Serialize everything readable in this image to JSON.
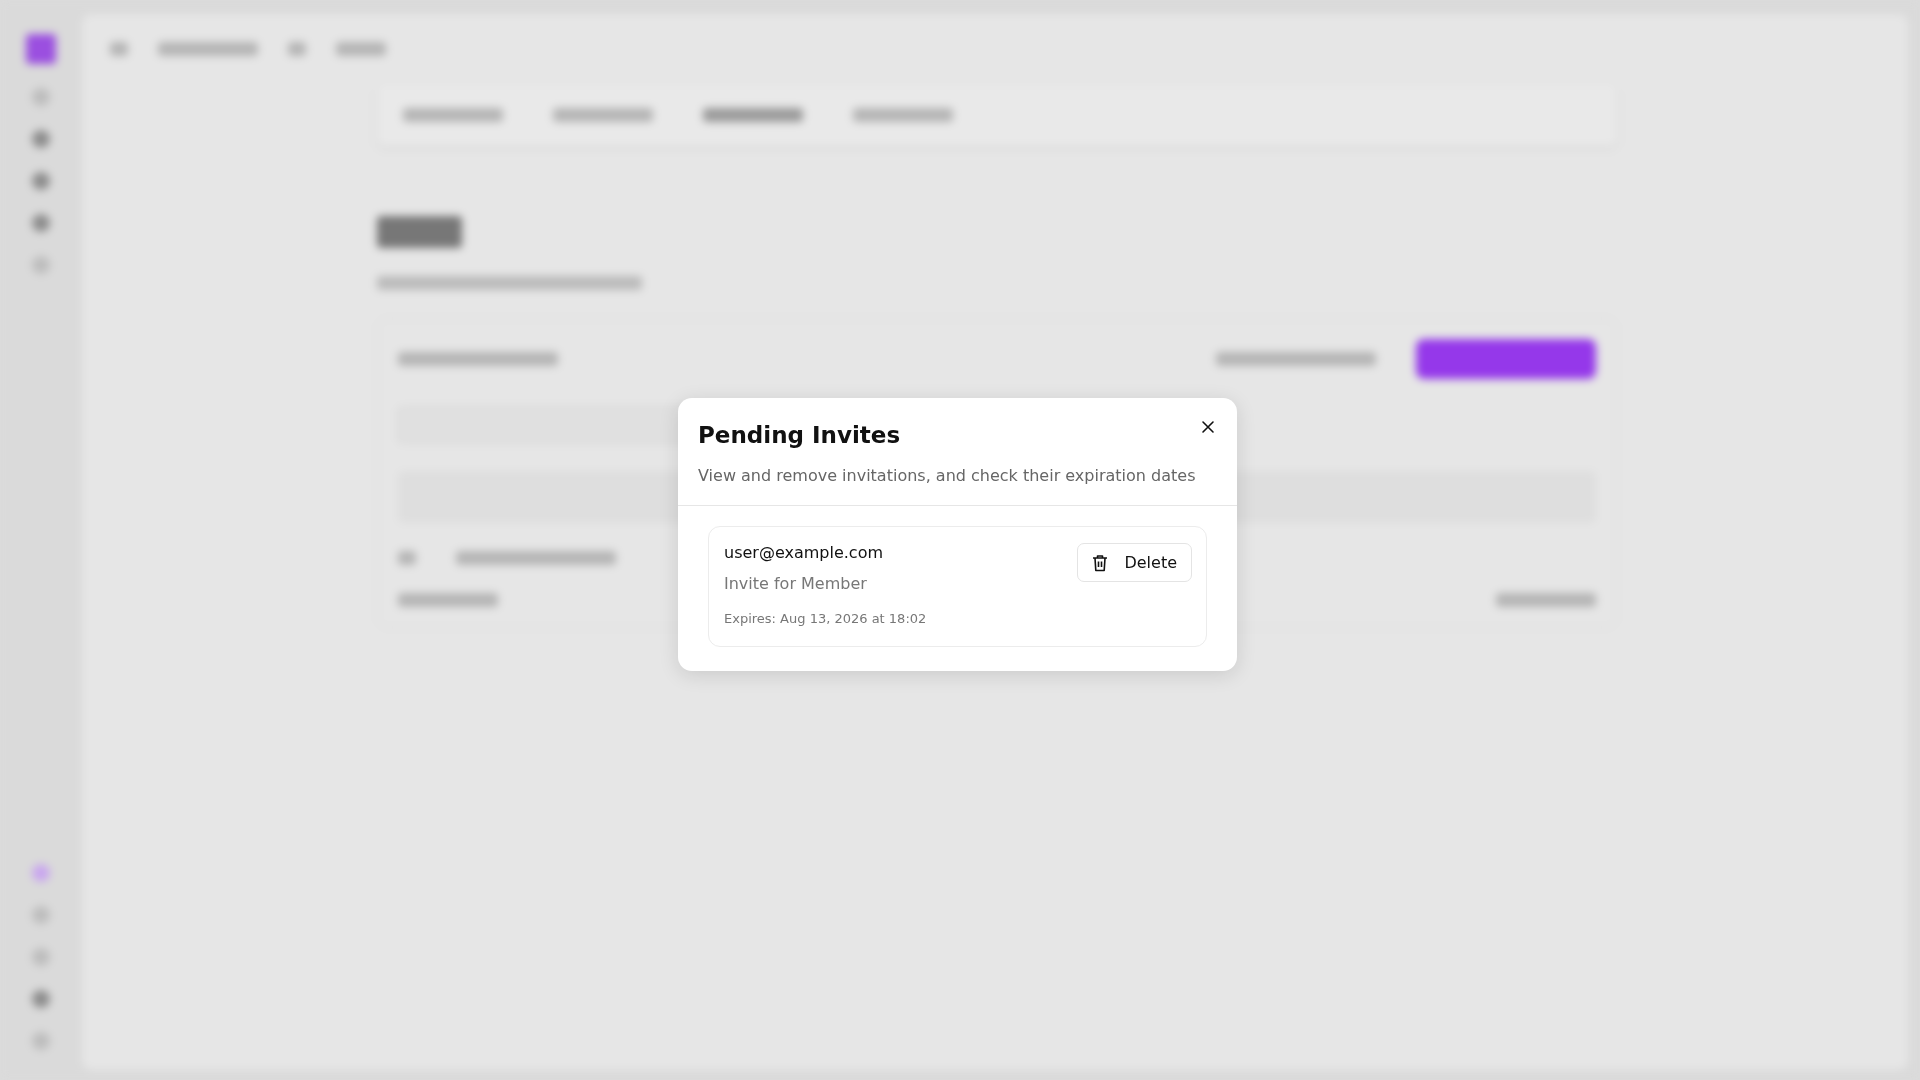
{
  "dialog": {
    "title": "Pending Invites",
    "description": "View and remove invitations, and check their expiration dates"
  },
  "invites": [
    {
      "email": "user@example.com",
      "role": "Invite for Member",
      "expires": "Expires: Aug 13, 2026 at 18:02",
      "action": "Delete"
    }
  ]
}
